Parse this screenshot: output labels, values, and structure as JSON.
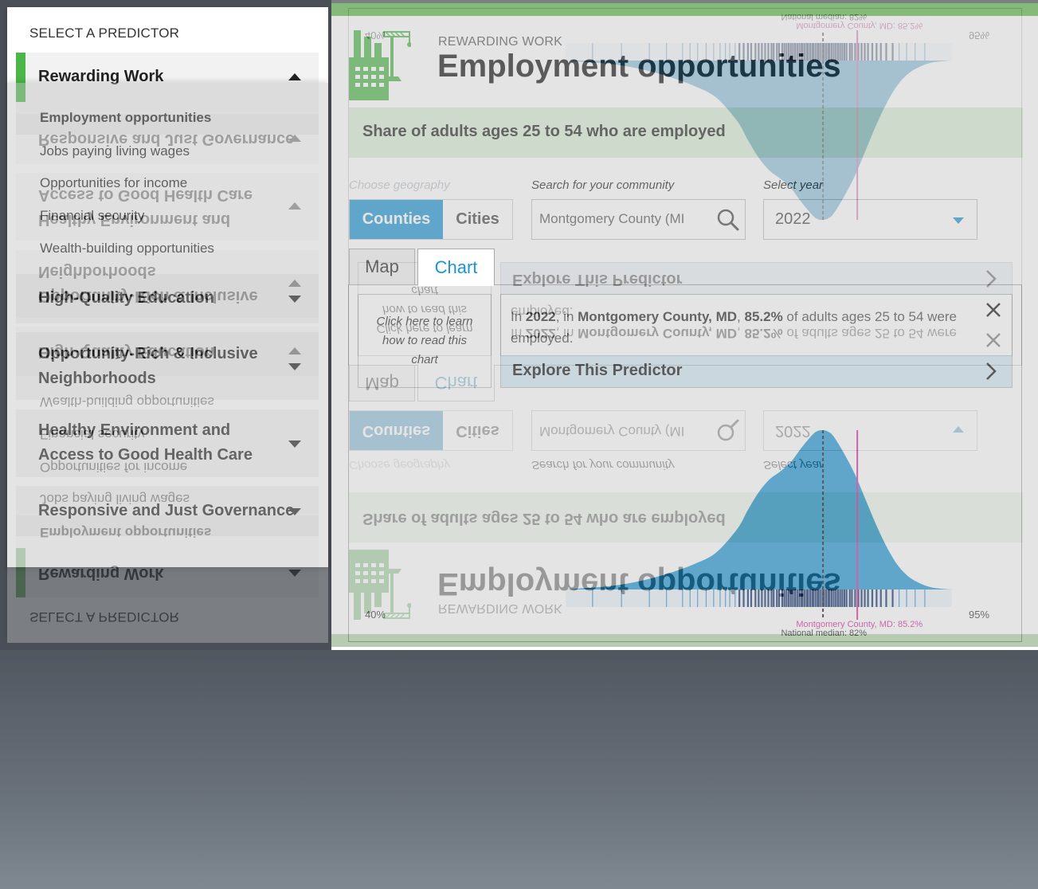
{
  "sidebar": {
    "title": "SELECT A PREDICTOR",
    "categories": [
      {
        "label": "Rewarding Work",
        "expanded": true
      },
      {
        "label": "High-Quality Education",
        "expanded": false
      },
      {
        "label": "Opportunity-Rich & Inclusive Neighborhoods",
        "expanded": false
      },
      {
        "label": "Healthy Environment and Access to Good Health Care",
        "expanded": false
      },
      {
        "label": "Responsive and Just Governance",
        "expanded": false
      }
    ],
    "subitems": [
      {
        "label": "Employment opportunities",
        "active": true
      },
      {
        "label": "Jobs paying living wages",
        "active": false
      },
      {
        "label": "Opportunities for income",
        "active": false
      },
      {
        "label": "Financial security",
        "active": false
      },
      {
        "label": "Wealth-building opportunities",
        "active": false
      }
    ]
  },
  "header": {
    "eyebrow": "REWARDING WORK",
    "title": "Employment opportunities",
    "icon": "factory-crane-icon"
  },
  "description": "Share of adults ages 25 to 54 who are employed",
  "controls": {
    "geography_label": "Choose geography",
    "geography_options": [
      "Counties",
      "Cities"
    ],
    "geography_selected": "Counties",
    "search_label": "Search for your community",
    "search_value": "Montgomery County (MI",
    "year_label": "Select year",
    "year_value": "2022"
  },
  "tabs": {
    "map": "Map",
    "chart": "Chart",
    "active": "Chart"
  },
  "learn": "Click here to learn how to read this chart",
  "info": {
    "year": "2022",
    "place": "Montgomery County, MD",
    "value": "85.2%",
    "seg1": "In ",
    "seg2": ", in ",
    "seg3": ", ",
    "seg4": " of adults ages 25 to 54 were employed.",
    "explore": "Explore This Predictor"
  },
  "colors": {
    "accent": "#1b95d3",
    "green": "#4cb648",
    "highlight": "#d6239b",
    "desc_bg": "#daeed4",
    "explore_bg": "#d4e9f5"
  },
  "chart_data": {
    "type": "area",
    "x_unit": "percent employed",
    "xlim": [
      40,
      95
    ],
    "x_tick_labels": [
      "40%",
      "95%"
    ],
    "density": {
      "x": [
        58,
        60,
        62,
        64,
        66,
        68,
        70,
        72,
        74,
        75,
        76,
        77,
        78,
        79,
        80,
        81,
        81.5,
        82,
        82.5,
        83,
        84,
        85,
        86,
        87,
        88,
        89,
        90,
        91,
        92,
        93,
        94
      ],
      "y": [
        0.0,
        0.01,
        0.02,
        0.04,
        0.07,
        0.11,
        0.16,
        0.23,
        0.38,
        0.5,
        0.61,
        0.69,
        0.74,
        0.8,
        0.89,
        0.97,
        0.995,
        1.0,
        0.99,
        0.96,
        0.85,
        0.72,
        0.56,
        0.4,
        0.26,
        0.15,
        0.08,
        0.04,
        0.015,
        0.005,
        0.0
      ]
    },
    "markers": [
      {
        "label": "Montgomery County, MD: 85.2%",
        "value": 85.2,
        "color": "#d6239b",
        "style": "solid"
      },
      {
        "label": "National median: 82%",
        "value": 82,
        "color": "#111111",
        "style": "dashed"
      }
    ],
    "rug_sample": [
      60.5,
      63.2,
      65.8,
      67.4,
      68.9,
      69.6,
      70.3,
      71.1,
      71.8,
      72.4,
      72.9,
      73.3,
      73.8,
      74.2,
      74.6,
      75.0,
      75.3,
      75.7,
      76.0,
      76.3,
      76.6,
      76.9,
      77.2,
      77.4,
      77.7,
      77.9,
      78.2,
      78.4,
      78.6,
      78.8,
      79.0,
      79.2,
      79.4,
      79.6,
      79.8,
      80.0,
      80.1,
      80.3,
      80.5,
      80.6,
      80.8,
      81.0,
      81.1,
      81.3,
      81.5,
      81.6,
      81.8,
      82.0,
      82.1,
      82.3,
      82.5,
      82.6,
      82.8,
      83.0,
      83.2,
      83.4,
      83.6,
      83.8,
      84.0,
      84.2,
      84.5,
      84.7,
      85.0,
      85.3,
      85.6,
      85.9,
      86.2,
      86.6,
      87.0,
      87.4,
      87.9,
      88.5,
      89.1,
      89.8,
      90.6,
      91.5
    ]
  }
}
